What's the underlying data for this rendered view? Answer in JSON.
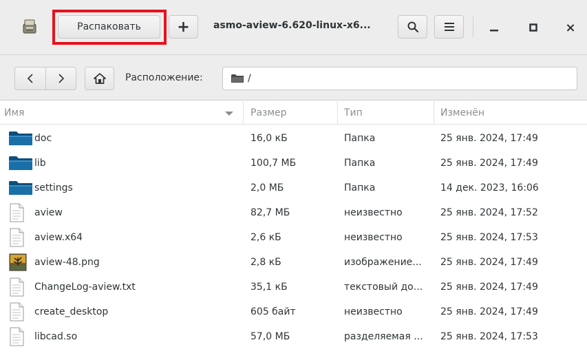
{
  "toolbar": {
    "extract_label": "Распаковать",
    "add_label": "+",
    "title": "asmo-aview-6.620-linux-x6...",
    "minimize_icon": "minimize-icon",
    "maximize_icon": "maximize-icon",
    "close_label": "×"
  },
  "location": {
    "label": "Расположение:",
    "path": "/"
  },
  "columns": {
    "name": "Имя",
    "size": "Размер",
    "type": "Тип",
    "modified": "Изменён"
  },
  "files": [
    {
      "name": "doc",
      "size": "16,0 кБ",
      "type": "Папка",
      "modified": "25 янв. 2024, 17:49",
      "icon": "folder-icon"
    },
    {
      "name": "lib",
      "size": "100,7 МБ",
      "type": "Папка",
      "modified": "25 янв. 2024, 17:49",
      "icon": "folder-icon"
    },
    {
      "name": "settings",
      "size": "2,0 МБ",
      "type": "Папка",
      "modified": "14 дек. 2023, 16:06",
      "icon": "folder-icon"
    },
    {
      "name": "aview",
      "size": "82,7 МБ",
      "type": "неизвестно",
      "modified": "25 янв. 2024, 17:52",
      "icon": "file-icon"
    },
    {
      "name": "aview.x64",
      "size": "2,6 кБ",
      "type": "неизвестно",
      "modified": "25 янв. 2024, 17:53",
      "icon": "file-icon"
    },
    {
      "name": "aview-48.png",
      "size": "2,8 кБ",
      "type": "изображение...",
      "modified": "25 янв. 2024, 17:49",
      "icon": "image-icon"
    },
    {
      "name": "ChangeLog-aview.txt",
      "size": "35,1 кБ",
      "type": "текстовый до...",
      "modified": "25 янв. 2024, 17:49",
      "icon": "file-icon"
    },
    {
      "name": "create_desktop",
      "size": "605 байт",
      "type": "неизвестно",
      "modified": "25 янв. 2024, 17:49",
      "icon": "file-icon"
    },
    {
      "name": "libcad.so",
      "size": "57,0 МБ",
      "type": "разделяемая ...",
      "modified": "25 янв. 2024, 17:53",
      "icon": "file-icon"
    }
  ],
  "colors": {
    "highlight": "#e8111c",
    "folder": "#1a6fa8",
    "header_bg": "#ededed"
  }
}
